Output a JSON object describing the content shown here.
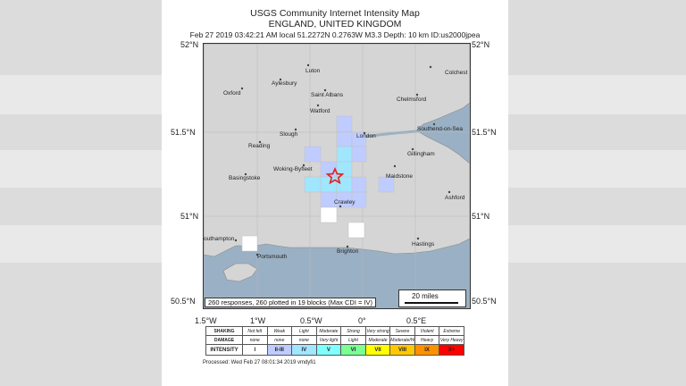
{
  "header": {
    "title": "USGS Community Internet Intensity Map",
    "location": "ENGLAND, UNITED KINGDOM",
    "event": "Feb 27 2019 03:42:21 AM local 51.2272N 0.2763W M3.3 Depth: 10 km ID:us2000jpea"
  },
  "lat_labels": {
    "l52": "52°N",
    "l515": "51.5°N",
    "l51": "51°N",
    "l505": "50.5°N"
  },
  "lon_labels": [
    "1.5°W",
    "1°W",
    "0.5°W",
    "0°",
    "0.5°E"
  ],
  "places": {
    "luton": "Luton",
    "colchester": "Colchest",
    "aylesbury": "Aylesbury",
    "oxford": "Oxford",
    "st_albans": "Saint Albans",
    "chelmsford": "Chelmsford",
    "watford": "Watford",
    "southend": "Southend-on-Sea",
    "slough": "Slough",
    "london": "London",
    "reading": "Reading",
    "gillingham": "Gillingham",
    "woking": "Woking-Byfleet",
    "maidstone": "Maidstone",
    "basingstoke": "Basingstoke",
    "ashford": "Ashford",
    "crawley": "Crawley",
    "southampton": "outhampton",
    "hastings": "Hastings",
    "portsmouth": "Portsmouth",
    "brighton": "Brighton"
  },
  "responses_text": "260 responses, 260 plotted in 19 blocks (Max CDI = IV)",
  "scale_label": "20 miles",
  "legend": {
    "shaking_label": "SHAKING",
    "damage_label": "DAMAGE",
    "intensity_label": "INTENSITY",
    "shaking": [
      "Not felt",
      "Weak",
      "Light",
      "Moderate",
      "Strong",
      "Very strong",
      "Severe",
      "Violent",
      "Extreme"
    ],
    "damage": [
      "none",
      "none",
      "none",
      "Very light",
      "Light",
      "Moderate",
      "Moderate/Heavy",
      "Heavy",
      "Very Heavy"
    ],
    "intensity": [
      "I",
      "II-III",
      "IV",
      "V",
      "VI",
      "VII",
      "VIII",
      "IX",
      "X+"
    ],
    "colors": [
      "#ffffff",
      "#bfccff",
      "#a0e6ff",
      "#80ffff",
      "#7aff93",
      "#ffff00",
      "#ffc800",
      "#ff9100",
      "#ff0000"
    ]
  },
  "processed": "Processed: Wed Feb 27 08:01:34 2019 vmdyfi1"
}
